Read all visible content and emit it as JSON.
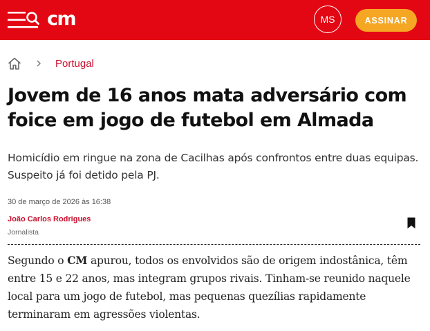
{
  "header": {
    "logo": "cm",
    "avatar_initials": "MS",
    "subscribe_label": "ASSINAR",
    "brand_color": "#e30613",
    "subscribe_color": "#f5a623",
    "icons": [
      "menu-icon",
      "search-icon",
      "home-icon",
      "chevron-right-icon",
      "bookmark-icon"
    ]
  },
  "breadcrumb": {
    "section": "Portugal"
  },
  "article": {
    "title": "Jovem de 16 anos mata adversário com foice em jogo de futebol em Almada",
    "lead": "Homicídio em ringue na zona de Cacilhas após confrontos entre duas equipas. Suspeito já foi detido pela PJ.",
    "date": "30 de março de 2026 às 16:38",
    "author_name": "João Carlos Rodrigues",
    "author_role": "Jornalista",
    "body_prefix": "Segundo o ",
    "body_brand": "CM",
    "body_suffix": " apurou, todos os envolvidos são de origem indostânica, têm entre 15 e 22 anos, mas integram grupos rivais. Tinham-se reunido naquele local para um jogo de futebol, mas pequenas quezílias rapidamente terminaram em agressões violentas."
  }
}
